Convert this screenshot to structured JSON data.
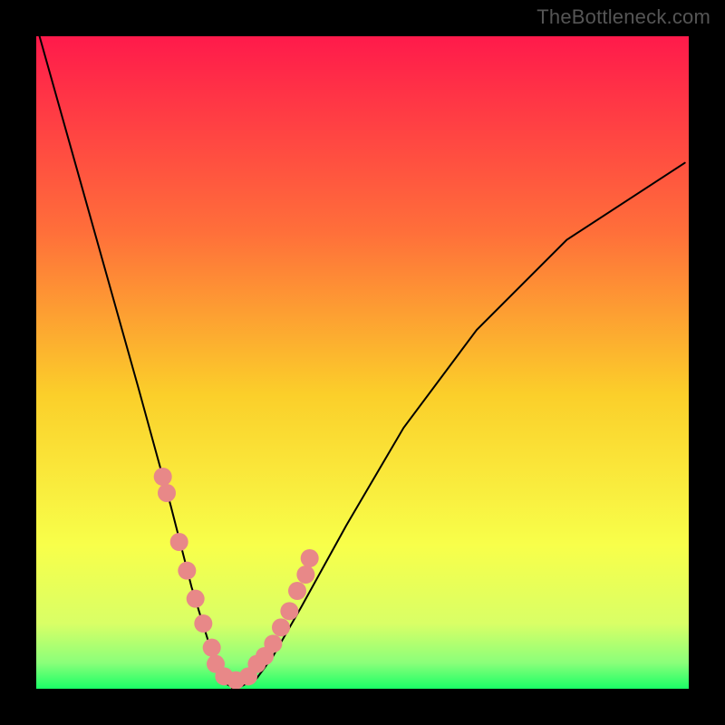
{
  "watermark": "TheBottleneck.com",
  "chart_data": {
    "type": "line",
    "title": "",
    "xlabel": "",
    "ylabel": "",
    "xlim": [
      0,
      100
    ],
    "ylim": [
      0,
      100
    ],
    "gradient_stops": [
      {
        "offset": 0.0,
        "color": "#ff1a4b"
      },
      {
        "offset": 0.3,
        "color": "#ff6f3a"
      },
      {
        "offset": 0.55,
        "color": "#fbcf2a"
      },
      {
        "offset": 0.78,
        "color": "#f8ff4a"
      },
      {
        "offset": 0.9,
        "color": "#d9ff66"
      },
      {
        "offset": 0.96,
        "color": "#8bff7a"
      },
      {
        "offset": 1.0,
        "color": "#1aff66"
      }
    ],
    "series": [
      {
        "name": "left-curve",
        "x": [
          0.5,
          7.0,
          15.6,
          20.6,
          23.8,
          26.3,
          28.1,
          28.8,
          30.0,
          30.0
        ],
        "values": [
          100,
          76.9,
          46.3,
          28.1,
          15.6,
          7.5,
          2.5,
          0.9,
          0.3,
          0.1
        ],
        "color": "#000000"
      },
      {
        "name": "right-curve",
        "x": [
          30.0,
          31.3,
          33.8,
          36.3,
          40.6,
          47.5,
          56.3,
          67.5,
          81.3,
          99.4
        ],
        "values": [
          0.1,
          0.3,
          1.6,
          5.0,
          12.5,
          25.0,
          40.0,
          55.0,
          68.8,
          80.6
        ],
        "color": "#000000"
      },
      {
        "name": "highlight-dots",
        "x": [
          19.4,
          20.0,
          21.9,
          23.1,
          24.4,
          25.6,
          26.9,
          27.5,
          28.8,
          30.6,
          32.5,
          33.8,
          35.0,
          36.3,
          37.5,
          38.8,
          40.0,
          41.3,
          41.9
        ],
        "values": [
          32.5,
          30.0,
          22.5,
          18.1,
          13.8,
          10.0,
          6.3,
          3.8,
          1.9,
          1.3,
          1.9,
          3.8,
          5.0,
          6.9,
          9.4,
          11.9,
          15.0,
          17.5,
          20.0
        ],
        "color": "#E88888",
        "marker": "circle"
      }
    ]
  }
}
